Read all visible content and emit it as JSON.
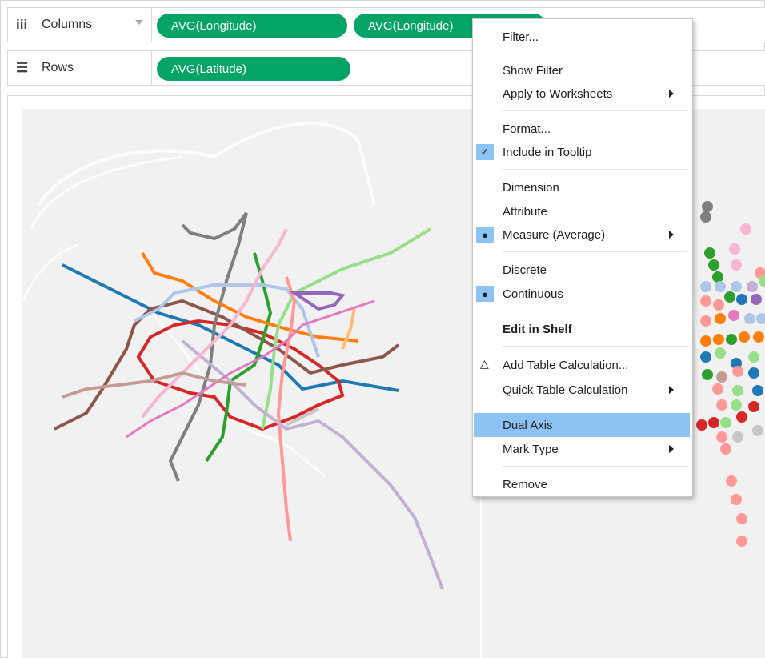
{
  "shelves": {
    "columns": {
      "label": "Columns",
      "icon": "columns-icon",
      "pills": [
        "AVG(Longitude)",
        "AVG(Longitude)"
      ]
    },
    "rows": {
      "label": "Rows",
      "icon": "rows-icon",
      "pills": [
        "AVG(Latitude)"
      ]
    }
  },
  "pill_color": "#03a466",
  "context_menu": {
    "items": [
      {
        "label": "Filter..."
      },
      {
        "label": "Show Filter"
      },
      {
        "label": "Apply to Worksheets",
        "submenu": true
      },
      {
        "label": "Format..."
      },
      {
        "label": "Include in Tooltip",
        "checked": true
      },
      {
        "label": "Dimension"
      },
      {
        "label": "Attribute"
      },
      {
        "label": "Measure (Average)",
        "selected": true,
        "submenu": true
      },
      {
        "label": "Discrete"
      },
      {
        "label": "Continuous",
        "selected": true
      },
      {
        "label": "Edit in Shelf",
        "bold": true
      },
      {
        "label": "Add Table Calculation...",
        "delta_icon": true
      },
      {
        "label": "Quick Table Calculation",
        "submenu": true
      },
      {
        "label": "Dual Axis",
        "highlighted": true
      },
      {
        "label": "Mark Type",
        "submenu": true
      },
      {
        "label": "Remove"
      }
    ],
    "highlight_color": "#8cc3f4"
  },
  "map": {
    "background": "#f1f1f1",
    "line_colors": [
      "#1f77b4",
      "#d62728",
      "#ff7f0e",
      "#2ca02c",
      "#7f7f7f",
      "#8c564b",
      "#e377c2",
      "#9467bd",
      "#c5b0d5",
      "#aec7e8",
      "#98df8a",
      "#ff9896",
      "#f7b6d2",
      "#c49c94",
      "#ffbb78",
      "#c7c7c7"
    ]
  }
}
